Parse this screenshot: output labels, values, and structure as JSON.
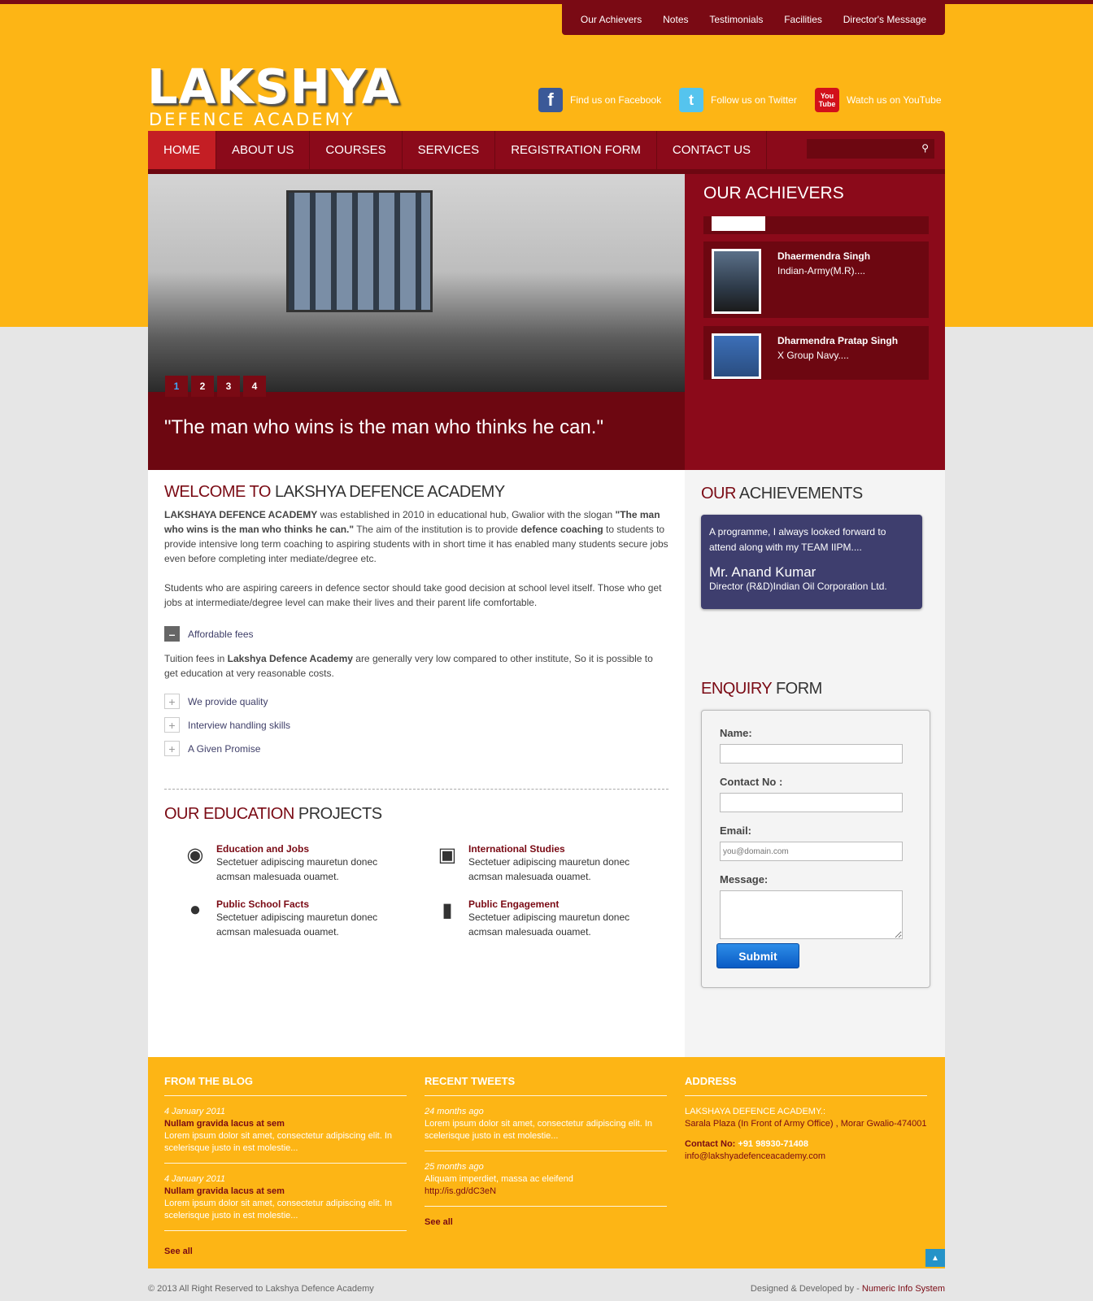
{
  "top_links": [
    "Our Achievers",
    "Notes",
    "Testimonials",
    "Facilities",
    "Director's Message"
  ],
  "logo": {
    "main": "LAKSHYA",
    "sub": "DEFENCE ACADEMY"
  },
  "social": {
    "facebook": "Find us on Facebook",
    "twitter": "Follow us on Twitter",
    "youtube": "Watch us on YouTube"
  },
  "nav": [
    "HOME",
    "ABOUT US",
    "COURSES",
    "SERVICES",
    "REGISTRATION FORM",
    "CONTACT US"
  ],
  "slider": {
    "dots": [
      "1",
      "2",
      "3",
      "4"
    ],
    "quote": "\"The man who wins is the man who thinks he can.\""
  },
  "achievers": {
    "title": "OUR ACHIEVERS",
    "items": [
      {
        "name": "Dhaermendra Singh",
        "detail": "Indian-Army(M.R)...."
      },
      {
        "name": "Dharmendra Pratap Singh",
        "detail": "X Group Navy...."
      }
    ]
  },
  "welcome": {
    "title_a": "WELCOME TO",
    "title_b": "LAKSHYA DEFENCE ACADEMY",
    "p1_lead": "LAKSHAYA DEFENCE ACADEMY",
    "p1_mid": "was established in 2010 in educational hub, Gwalior with the slogan",
    "p1_quote": "\"The man who wins is the man who thinks he can.\"",
    "p1_mid2": "The aim of the institution is to provide",
    "p1_bold2": "defence coaching",
    "p1_tail": "to students to provide intensive long term coaching to aspiring students with in short time it has enabled many students secure jobs even before completing inter mediate/degree etc.",
    "p2": "Students who are aspiring careers in defence sector should take good decision at school level itself. Those who get jobs at intermediate/degree level can make their lives and their parent life comfortable."
  },
  "accordion": {
    "open_title": "Affordable fees",
    "open_text_a": "Tuition fees in",
    "open_text_bold": "Lakshya Defence Academy",
    "open_text_b": "are generally very low compared to other institute, So it is possible to get education at very reasonable costs.",
    "closed": [
      "We provide quality",
      "Interview handling skills",
      "A Given Promise"
    ]
  },
  "projects": {
    "title_a": "OUR EDUCATION",
    "title_b": "PROJECTS",
    "items": [
      {
        "title": "Education and Jobs",
        "desc": "Sectetuer adipiscing mauretun donec acmsan malesuada ouamet.",
        "icon": "globe-icon"
      },
      {
        "title": "International Studies",
        "desc": "Sectetuer adipiscing mauretun donec acmsan malesuada ouamet.",
        "icon": "clipboard-icon"
      },
      {
        "title": "Public School Facts",
        "desc": "Sectetuer adipiscing mauretun donec acmsan malesuada ouamet.",
        "icon": "world-icon"
      },
      {
        "title": "Public Engagement",
        "desc": "Sectetuer adipiscing mauretun donec acmsan malesuada ouamet.",
        "icon": "folder-icon"
      }
    ]
  },
  "achievements": {
    "title_a": "OUR",
    "title_b": "ACHIEVEMENTS",
    "quote": "A programme, I always looked forward to attend along with my TEAM IIPM....",
    "author": "Mr. Anand Kumar",
    "role": "Director (R&D)Indian Oil Corporation Ltd."
  },
  "enquiry": {
    "title_a": "ENQUIRY",
    "title_b": "FORM",
    "name_label": "Name:",
    "contact_label": "Contact No :",
    "email_label": "Email:",
    "email_placeholder": "you@domain.com",
    "message_label": "Message:",
    "submit": "Submit"
  },
  "footer": {
    "blog": {
      "title": "FROM THE BLOG",
      "posts": [
        {
          "date": "4 January 2011",
          "title": "Nullam gravida lacus at sem",
          "text": "Lorem ipsum dolor sit amet, consectetur adipiscing elit. In scelerisque justo in est molestie..."
        },
        {
          "date": "4 January 2011",
          "title": "Nullam gravida lacus at sem",
          "text": "Lorem ipsum dolor sit amet, consectetur adipiscing elit. In scelerisque justo in est molestie..."
        }
      ],
      "see_all": "See all"
    },
    "tweets": {
      "title": "RECENT TWEETS",
      "items": [
        {
          "date": "24 months ago",
          "text": "Lorem ipsum dolor sit amet, consectetur adipiscing elit. In scelerisque justo in est molestie..."
        },
        {
          "date": "25 months ago",
          "text": "Aliquam imperdiet, massa ac eleifend",
          "link": "http://is.gd/dC3eN"
        }
      ],
      "see_all": "See all"
    },
    "address": {
      "title": "ADDRESS",
      "org": "LAKSHAYA DEFENCE ACADEMY.:",
      "line": "Sarala Plaza (In Front of Army Office) , Morar Gwalio-474001",
      "contact_label": "Contact No:",
      "contact_value": "+91 98930-71408",
      "email": "info@lakshyadefenceacademy.com"
    },
    "copyright": "© 2013 All Right Reserved to Lakshya Defence Academy",
    "credit_label": "Designed & Developed by -",
    "credit_name": "Numeric Info System"
  },
  "colors": {
    "yellow": "#fdb515",
    "maroon": "#8b0a1a",
    "dark_maroon": "#6d0711",
    "active_red": "#c41e24"
  }
}
